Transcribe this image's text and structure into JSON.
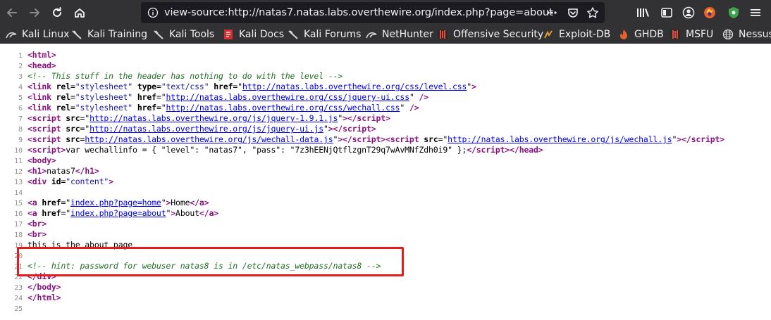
{
  "browser": {
    "url": "view-source:http://natas7.natas.labs.overthewire.org/index.php?page=about",
    "bookmarks": [
      "Kali Linux",
      "Kali Training",
      "Kali Tools",
      "Kali Docs",
      "Kali Forums",
      "NetHunter",
      "Offensive Security",
      "Exploit-DB",
      "GHDB",
      "MSFU",
      "Nessus"
    ]
  },
  "source": {
    "line_numbers": [
      "1",
      "2",
      "3",
      "4",
      "5",
      "6",
      "7",
      "8",
      "9",
      "10",
      "11",
      "12",
      "13",
      "14",
      "15",
      "16",
      "17",
      "18",
      "19",
      "20",
      "21",
      "22",
      "23",
      "24",
      "25"
    ],
    "doctype": "<html>",
    "head_open": "<head>",
    "header_comment": "<!-- This stuff in the header has nothing to do with the level -->",
    "link_level": "http://natas.labs.overthewire.org/css/level.css",
    "link_jqueryui_css": "http://natas.labs.overthewire.org/css/jquery-ui.css",
    "link_wechall_css": "http://natas.labs.overthewire.org/css/wechall.css",
    "script_jquery": "http://natas.labs.overthewire.org/js/jquery-1.9.1.js",
    "script_jqueryui": "http://natas.labs.overthewire.org/js/jquery-ui.js",
    "script_wechall_data": "http://natas.labs.overthewire.org/js/wechall-data.js",
    "script_wechall": "http://natas.labs.overthewire.org/js/wechall.js",
    "wechall_js": "var wechallinfo = { \"level\": \"natas7\", \"pass\": \"7z3hEENjQtflzgnT29q7wAvMNfZdh0i9\" };",
    "h1_text": "natas7",
    "div_id": "\"content\"",
    "link_home_href": "index.php?page=home",
    "link_home_text": "Home",
    "link_about_href": "index.php?page=about",
    "link_about_text": "About",
    "body_text": "this is the about page",
    "hint_comment": "<!-- hint: password for webuser natas8 is in /etc/natas_webpass/natas8 -->"
  },
  "colors": {
    "toolbar_bg": "#323234",
    "tag": "#881280",
    "attr_value": "#1a1aa6",
    "comment": "#236e25",
    "link": "#0000ee",
    "highlight_box": "#e81b1b"
  }
}
